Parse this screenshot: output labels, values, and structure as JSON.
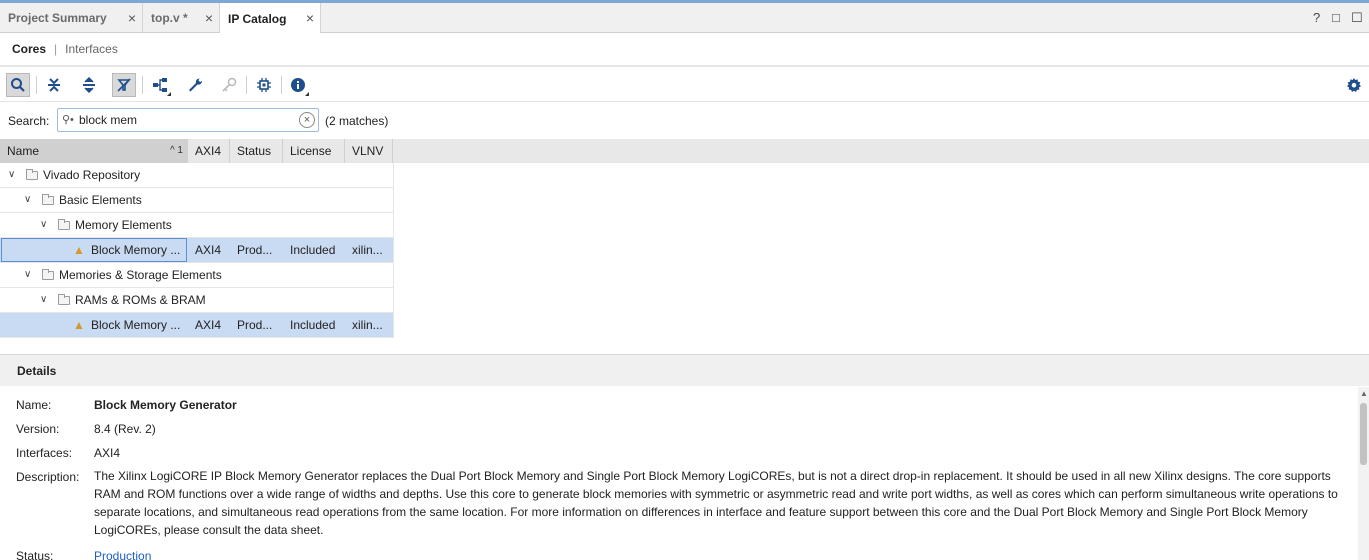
{
  "tabs": [
    {
      "label": "Project Summary",
      "close": "×"
    },
    {
      "label": "top.v *",
      "close": "×"
    },
    {
      "label": "IP Catalog",
      "close": "×"
    }
  ],
  "window_controls": {
    "help": "?",
    "restore": "□",
    "maximize": "☐"
  },
  "subtabs": {
    "cores": "Cores",
    "separator": "|",
    "interfaces": "Interfaces"
  },
  "toolbar": {
    "icons": [
      "search-icon",
      "collapse-all-icon",
      "expand-all-icon",
      "filter-icon",
      "hierarchy-icon",
      "wrench-icon",
      "key-icon",
      "chip-icon",
      "info-icon",
      "gear-icon"
    ]
  },
  "search": {
    "label": "Search:",
    "value": "block mem",
    "matches": "(2 matches)"
  },
  "table": {
    "columns": [
      "Name",
      "AXI4",
      "Status",
      "License",
      "VLNV"
    ],
    "sort_indicator": "^ 1",
    "rows": [
      {
        "name": "Vivado Repository"
      },
      {
        "name": "Basic Elements"
      },
      {
        "name": "Memory Elements"
      },
      {
        "name": "Block Memory ...",
        "axi4": "AXI4",
        "status": "Prod...",
        "license": "Included",
        "vlnv": "xilin..."
      },
      {
        "name": "Memories & Storage Elements"
      },
      {
        "name": "RAMs & ROMs & BRAM"
      },
      {
        "name": "Block Memory ...",
        "axi4": "AXI4",
        "status": "Prod...",
        "license": "Included",
        "vlnv": "xilin..."
      }
    ]
  },
  "details": {
    "title": "Details",
    "name_label": "Name:",
    "name_value": "Block Memory Generator",
    "version_label": "Version:",
    "version_value": "8.4 (Rev. 2)",
    "interfaces_label": "Interfaces:",
    "interfaces_value": "AXI4",
    "description_label": "Description:",
    "description_value": "The Xilinx LogiCORE IP Block Memory Generator replaces the Dual Port Block Memory and Single Port Block Memory LogiCOREs, but is not a direct drop-in replacement.  It should be used in all new Xilinx designs. The core supports RAM and ROM functions over a wide range of widths and depths. Use this core to generate block memories with symmetric or asymmetric read and write port widths, as well as cores which can perform simultaneous write operations to separate locations, and simultaneous read operations from the same location. For more information on differences in interface and feature support between this core and the Dual Port Block Memory and Single Port Block Memory LogiCOREs, please consult the data sheet.",
    "status_label": "Status:",
    "status_value": "Production"
  }
}
